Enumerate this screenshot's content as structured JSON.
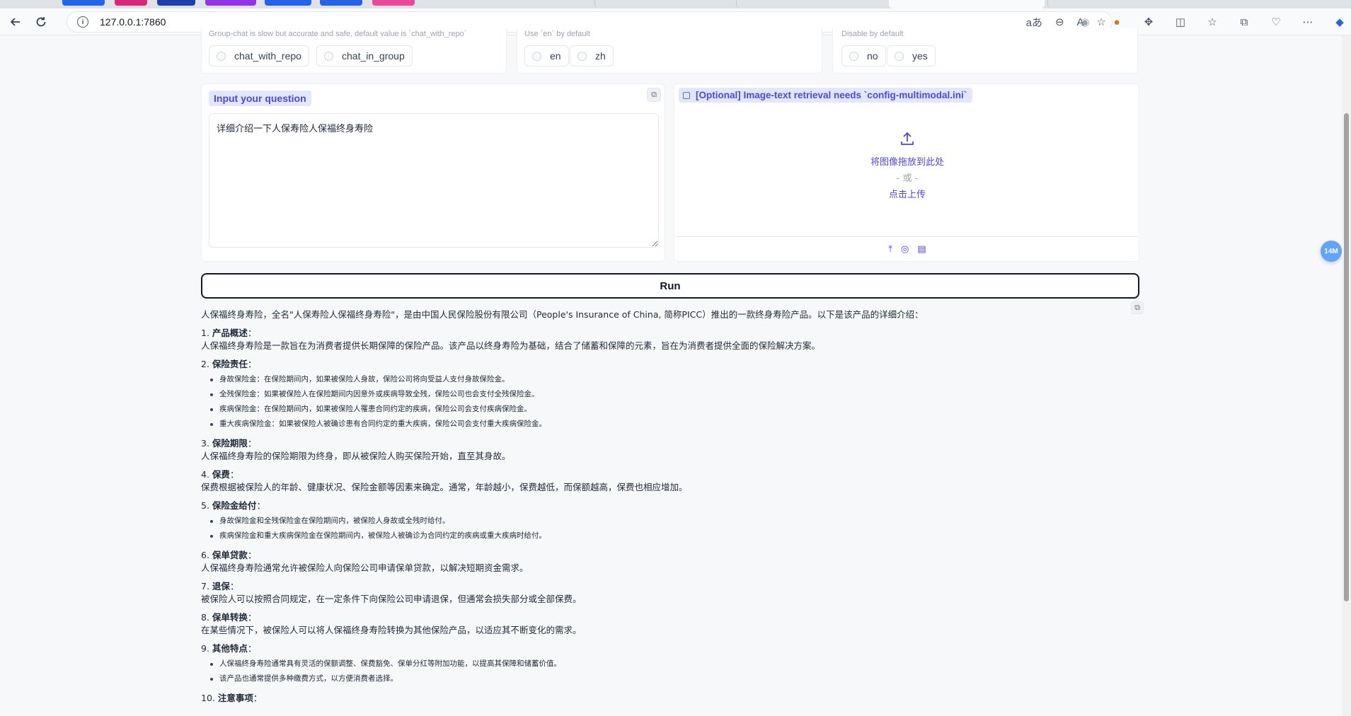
{
  "browser": {
    "url": "127.0.0.1:7860",
    "tab_colors": [
      "#2563eb",
      "#db2777",
      "#1e40af",
      "#9333ea",
      "#2563eb",
      "#2563eb",
      "#ec4899"
    ]
  },
  "options": {
    "chat_mode": {
      "hint": "Group-chat is slow but accurate and safe, default value is `chat_with_repo`",
      "choices": [
        "chat_with_repo",
        "chat_in_group"
      ]
    },
    "language": {
      "hint": "Use `en` by default",
      "choices": [
        "en",
        "zh"
      ]
    },
    "toggle": {
      "hint": "Disable by default",
      "choices": [
        "no",
        "yes"
      ]
    }
  },
  "question": {
    "label": "Input your question",
    "value": "详细介绍一下人保寿险人保福终身寿险"
  },
  "image_upload": {
    "label": "[Optional] Image-text retrieval needs `config-multimodal.ini`",
    "drop_text": "将图像拖放到此处",
    "or_text": "- 或 -",
    "click_text": "点击上传"
  },
  "run_label": "Run",
  "answer": {
    "intro": "人保福终身寿险，全名\"人保寿险人保福终身寿险\"，是由中国人民保险股份有限公司（People's Insurance of China, 简称PICC）推出的一款终身寿险产品。以下是该产品的详细介绍：",
    "sections": [
      {
        "num": "1.",
        "title": "产品概述",
        "body": "人保福终身寿险是一款旨在为消费者提供长期保障的保险产品。该产品以终身寿险为基础，结合了储蓄和保障的元素，旨在为消费者提供全面的保险解决方案。"
      },
      {
        "num": "2.",
        "title": "保险责任",
        "items": [
          "身故保险金：在保险期间内，如果被保险人身故，保险公司将向受益人支付身故保险金。",
          "全残保险金：如果被保险人在保险期间内因意外或疾病导致全残，保险公司也会支付全残保险金。",
          "疾病保险金：在保险期间内，如果被保险人罹患合同约定的疾病，保险公司会支付疾病保险金。",
          "重大疾病保险金：如果被保险人被确诊患有合同约定的重大疾病，保险公司会支付重大疾病保险金。"
        ]
      },
      {
        "num": "3.",
        "title": "保险期限",
        "body": "人保福终身寿险的保险期限为终身，即从被保险人购买保险开始，直至其身故。"
      },
      {
        "num": "4.",
        "title": "保费",
        "body": "保费根据被保险人的年龄、健康状况、保险金额等因素来确定。通常，年龄越小，保费越低，而保额越高，保费也相应增加。"
      },
      {
        "num": "5.",
        "title": "保险金给付",
        "items": [
          "身故保险金和全残保险金在保险期间内，被保险人身故或全残时给付。",
          "疾病保险金和重大疾病保险金在保险期间内，被保险人被确诊为合同约定的疾病或重大疾病时给付。"
        ]
      },
      {
        "num": "6.",
        "title": "保单贷款",
        "body": "人保福终身寿险通常允许被保险人向保险公司申请保单贷款，以解决短期资金需求。"
      },
      {
        "num": "7.",
        "title": "退保",
        "body": "被保险人可以按照合同规定，在一定条件下向保险公司申请退保，但通常会损失部分或全部保费。"
      },
      {
        "num": "8.",
        "title": "保单转换",
        "body": "在某些情况下，被保险人可以将人保福终身寿险转换为其他保险产品，以适应其不断变化的需求。"
      },
      {
        "num": "9.",
        "title": "其他特点",
        "items": [
          "人保福终身寿险通常具有灵活的保额调整、保费豁免、保单分红等附加功能，以提高其保障和储蓄价值。",
          "该产品也通常提供多种缴费方式，以方便消费者选择。"
        ]
      },
      {
        "num": "10.",
        "title": "注意事项",
        "body": ""
      }
    ]
  },
  "float_badge": "14M"
}
